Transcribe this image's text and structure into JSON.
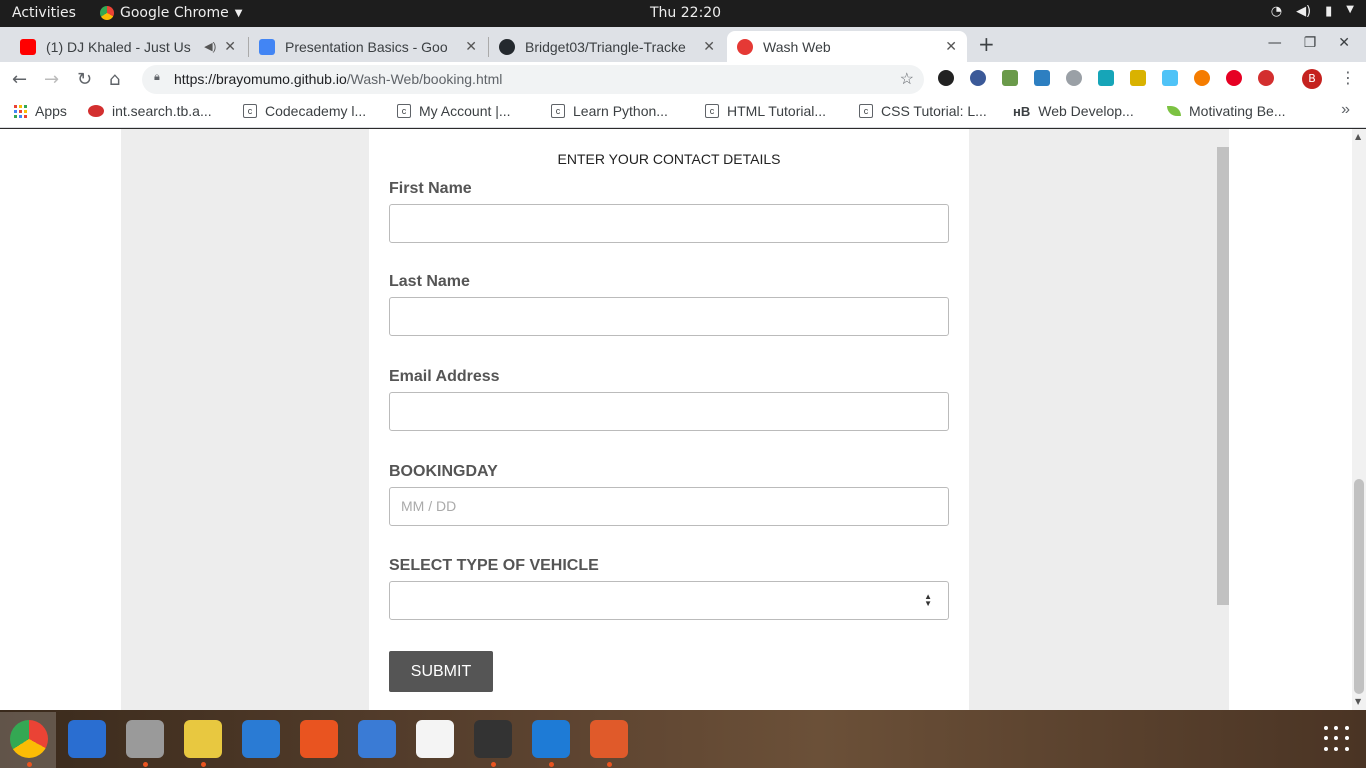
{
  "topbar": {
    "activities": "Activities",
    "app_name": "Google Chrome",
    "clock": "Thu 22:20"
  },
  "tabs": [
    {
      "title": "(1) DJ Khaled - Just Us",
      "favicon": "youtube-icon",
      "color": "#ff0000"
    },
    {
      "title": "Presentation Basics - Goo",
      "favicon": "google-docs-icon",
      "color": "#4285f4"
    },
    {
      "title": "Bridget03/Triangle-Tracke",
      "favicon": "github-icon",
      "color": "#24292e"
    },
    {
      "title": "Wash Web",
      "favicon": "wash-web-icon",
      "color": "#e53935",
      "active": true
    }
  ],
  "omnibox": {
    "url_host": "https://brayomumo.github.io",
    "url_path": "/Wash-Web/booking.html"
  },
  "avatar_letter": "B",
  "bookmarks": [
    {
      "label": "Apps",
      "icon": "apps-grid-icon"
    },
    {
      "label": "int.search.tb.a...",
      "icon": "ask-icon"
    },
    {
      "label": "Codecademy l...",
      "icon": "codecademy-icon"
    },
    {
      "label": "My Account |...",
      "icon": "codecademy-icon"
    },
    {
      "label": "Learn Python...",
      "icon": "codecademy-icon"
    },
    {
      "label": "HTML Tutorial...",
      "icon": "codecademy-icon"
    },
    {
      "label": "CSS Tutorial: L...",
      "icon": "codecademy-icon"
    },
    {
      "label": "Web Develop...",
      "icon": "web-develop-icon"
    },
    {
      "label": "Motivating Be...",
      "icon": "leaf-icon"
    }
  ],
  "form": {
    "heading": "ENTER YOUR CONTACT DETAILS",
    "first_name_label": "First Name",
    "last_name_label": "Last Name",
    "email_label": "Email Address",
    "booking_day_label": "BOOKINGDAY",
    "booking_day_placeholder": "MM / DD",
    "vehicle_label": "SELECT TYPE OF VEHICLE",
    "submit_label": "SUBMIT"
  },
  "dock": [
    {
      "name": "chrome-icon",
      "color": "#4285f4",
      "running": true
    },
    {
      "name": "thunderbird-icon",
      "color": "#2a6ed1",
      "running": false
    },
    {
      "name": "files-icon",
      "color": "#9a9a9a",
      "running": true
    },
    {
      "name": "rhythmbox-icon",
      "color": "#e8c840",
      "running": true
    },
    {
      "name": "libreoffice-writer-icon",
      "color": "#2a7bd4",
      "running": false
    },
    {
      "name": "software-center-icon",
      "color": "#e95420",
      "running": false
    },
    {
      "name": "help-icon",
      "color": "#3a7bd5",
      "running": false
    },
    {
      "name": "amazon-icon",
      "color": "#f4f4f4",
      "running": false
    },
    {
      "name": "terminal-icon",
      "color": "#333333",
      "running": true
    },
    {
      "name": "vscode-icon",
      "color": "#1e7bd6",
      "running": true
    },
    {
      "name": "libreoffice-impress-icon",
      "color": "#e05a2a",
      "running": true
    }
  ]
}
